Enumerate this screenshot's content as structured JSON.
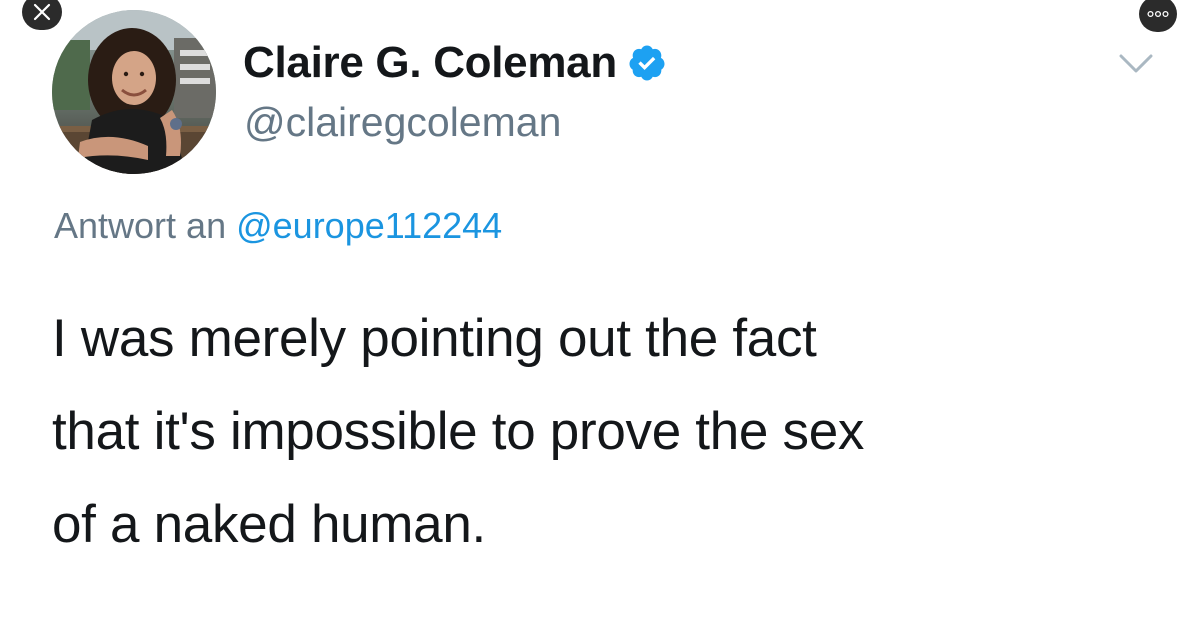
{
  "colors": {
    "text_primary": "#14171a",
    "text_secondary": "#657786",
    "link": "#1b95e0",
    "verified": "#1da1f2",
    "overlay_button": "#2b2b2b"
  },
  "viewer": {
    "close_icon": "close-icon",
    "more_icon": "more-dots-icon"
  },
  "tweet": {
    "author": {
      "display_name": "Claire G. Coleman",
      "handle": "@clairegcoleman",
      "verified_icon": "verified-badge-icon"
    },
    "menu_icon": "chevron-down-icon",
    "reply_to": {
      "prefix": "Antwort an",
      "handle": "@europe112244"
    },
    "text_lines": [
      "I was merely pointing out the fact",
      "that it's impossible to prove the sex",
      "of a naked human."
    ]
  }
}
